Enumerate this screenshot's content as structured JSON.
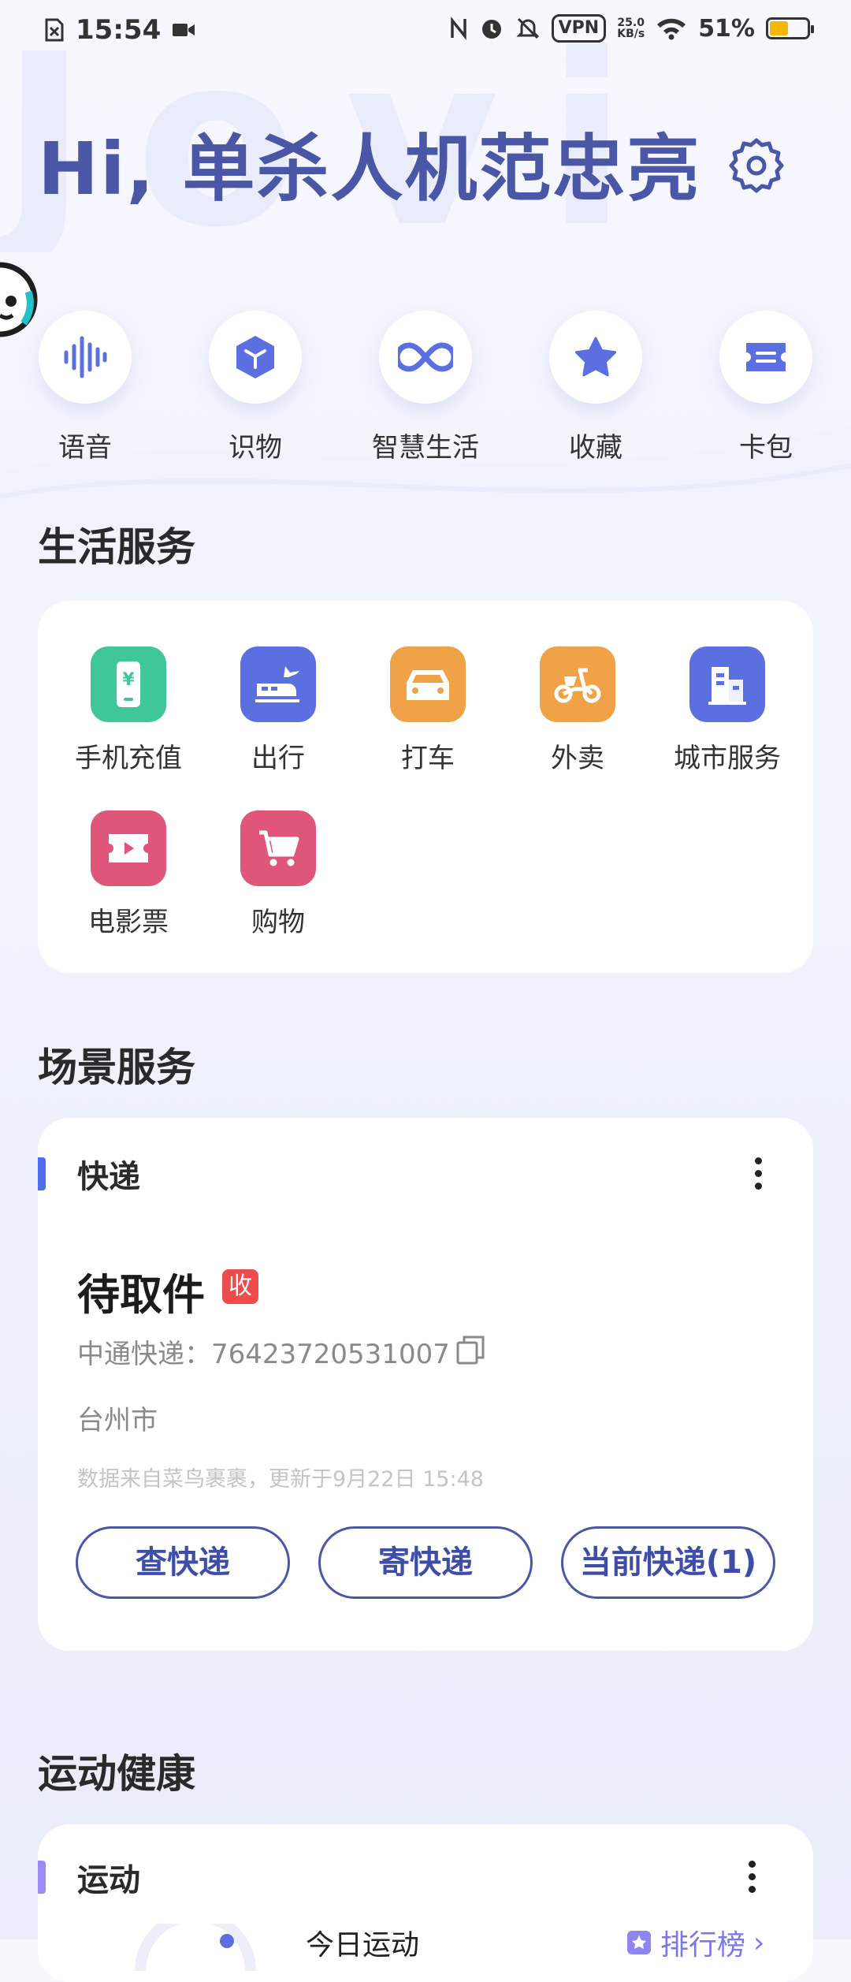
{
  "status_bar": {
    "time": "15:54",
    "vpn": "VPN",
    "net_speed_value": "25.0",
    "net_speed_unit": "KB/s",
    "battery_percent": "51%",
    "battery_level": 0.51,
    "battery_color": "#f5b800"
  },
  "header": {
    "watermark": "Jovi",
    "greeting": "Hi, 单杀人机范忠亮",
    "settings_icon": "gear-icon"
  },
  "quick_actions": [
    {
      "label": "语音",
      "icon": "voice-wave-icon"
    },
    {
      "label": "识物",
      "icon": "cube-icon"
    },
    {
      "label": "智慧生活",
      "icon": "infinity-icon"
    },
    {
      "label": "收藏",
      "icon": "star-icon"
    },
    {
      "label": "卡包",
      "icon": "ticket-icon"
    }
  ],
  "life_services": {
    "title": "生活服务",
    "items": [
      {
        "label": "手机充值",
        "icon": "phone-topup-icon",
        "color": "#3fc79a"
      },
      {
        "label": "出行",
        "icon": "train-plane-icon",
        "color": "#5b6fe0"
      },
      {
        "label": "打车",
        "icon": "car-icon",
        "color": "#f0a246"
      },
      {
        "label": "外卖",
        "icon": "scooter-icon",
        "color": "#f0a246"
      },
      {
        "label": "城市服务",
        "icon": "building-icon",
        "color": "#5b6fe0"
      },
      {
        "label": "电影票",
        "icon": "movie-ticket-icon",
        "color": "#e0567a"
      },
      {
        "label": "购物",
        "icon": "cart-icon",
        "color": "#e0567a"
      }
    ]
  },
  "scene_services": {
    "title": "场景服务",
    "express": {
      "card_title": "快递",
      "accent_color": "#4f6df0",
      "status": "待取件",
      "badge": "收",
      "tracking": "中通快递：76423720531007",
      "city": "台州市",
      "source_note": "数据来自菜鸟裹裹，更新于9月22日 15:48",
      "buttons": [
        "查快递",
        "寄快递",
        "当前快递(1)"
      ]
    }
  },
  "health": {
    "title": "运动健康",
    "card_title": "运动",
    "accent_color": "#9b8cf5",
    "subtitle": "今日运动",
    "rank_label": "排行榜"
  }
}
